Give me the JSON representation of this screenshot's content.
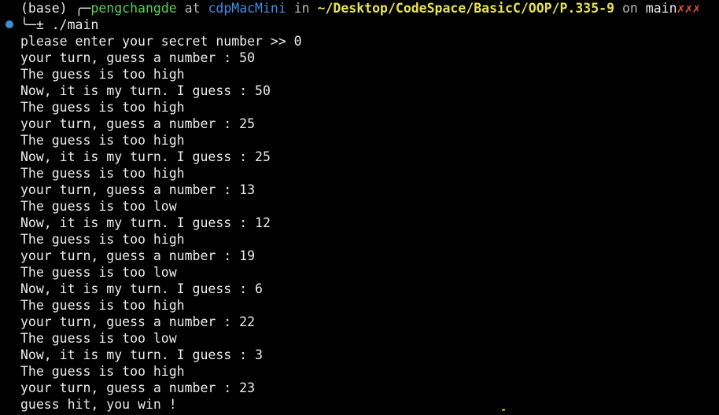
{
  "prompt": {
    "env": "(base)",
    "corner": "╭─",
    "user": "pengchangde",
    "at": "at",
    "host": "cdpMacMini",
    "in": "in",
    "path": "~/Desktop/CodeSpace/BasicC/OOP/P.335-9",
    "on": "on",
    "branch": "main",
    "dirty": "✗✗✗",
    "corner2": "╰─",
    "symbol": "±",
    "command": "./main"
  },
  "indicator_color": "#3c8fd9",
  "output": [
    "please enter your secret number >> 0",
    "your turn, guess a number : 50",
    "The guess is too high",
    "Now, it is my turn. I guess : 50",
    "The guess is too high",
    "your turn, guess a number : 25",
    "The guess is too high",
    "Now, it is my turn. I guess : 25",
    "The guess is too high",
    "your turn, guess a number : 13",
    "The guess is too low",
    "Now, it is my turn. I guess : 12",
    "The guess is too high",
    "your turn, guess a number : 19",
    "The guess is too low",
    "Now, it is my turn. I guess : 6",
    "The guess is too high",
    "your turn, guess a number : 22",
    "The guess is too low",
    "Now, it is my turn. I guess : 3",
    "The guess is too high",
    "your turn, guess a number : 23",
    "guess hit, you win !"
  ]
}
